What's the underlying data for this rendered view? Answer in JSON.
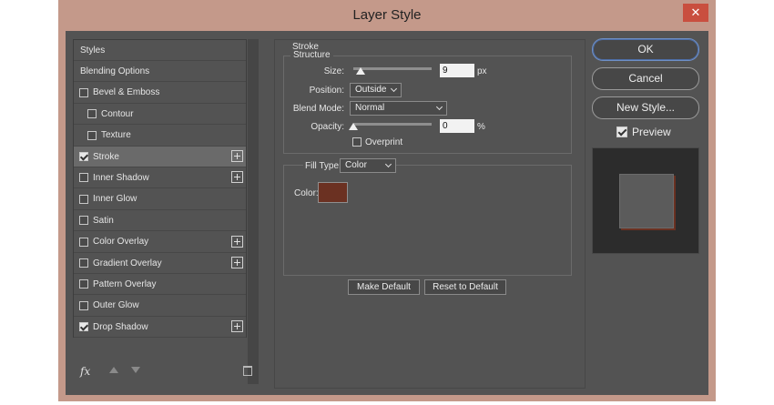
{
  "window": {
    "title": "Layer Style",
    "close_icon": "close-icon"
  },
  "styles_panel": {
    "items": [
      {
        "label": "Styles",
        "checkbox": false,
        "checked": false,
        "has_plus": false,
        "indent": false,
        "active": false
      },
      {
        "label": "Blending Options",
        "checkbox": false,
        "checked": false,
        "has_plus": false,
        "indent": false,
        "active": false
      },
      {
        "label": "Bevel & Emboss",
        "checkbox": true,
        "checked": false,
        "has_plus": false,
        "indent": false,
        "active": false
      },
      {
        "label": "Contour",
        "checkbox": true,
        "checked": false,
        "has_plus": false,
        "indent": true,
        "active": false
      },
      {
        "label": "Texture",
        "checkbox": true,
        "checked": false,
        "has_plus": false,
        "indent": true,
        "active": false
      },
      {
        "label": "Stroke",
        "checkbox": true,
        "checked": true,
        "has_plus": true,
        "indent": false,
        "active": true
      },
      {
        "label": "Inner Shadow",
        "checkbox": true,
        "checked": false,
        "has_plus": true,
        "indent": false,
        "active": false
      },
      {
        "label": "Inner Glow",
        "checkbox": true,
        "checked": false,
        "has_plus": false,
        "indent": false,
        "active": false
      },
      {
        "label": "Satin",
        "checkbox": true,
        "checked": false,
        "has_plus": false,
        "indent": false,
        "active": false
      },
      {
        "label": "Color Overlay",
        "checkbox": true,
        "checked": false,
        "has_plus": true,
        "indent": false,
        "active": false
      },
      {
        "label": "Gradient Overlay",
        "checkbox": true,
        "checked": false,
        "has_plus": true,
        "indent": false,
        "active": false
      },
      {
        "label": "Pattern Overlay",
        "checkbox": true,
        "checked": false,
        "has_plus": false,
        "indent": false,
        "active": false
      },
      {
        "label": "Outer Glow",
        "checkbox": true,
        "checked": false,
        "has_plus": false,
        "indent": false,
        "active": false
      },
      {
        "label": "Drop Shadow",
        "checkbox": true,
        "checked": true,
        "has_plus": true,
        "indent": false,
        "active": false
      }
    ],
    "footer": {
      "fx_label": "fx"
    }
  },
  "stroke": {
    "section_title": "Stroke",
    "structure_title": "Structure",
    "size_label": "Size:",
    "size_value": "9",
    "size_unit": "px",
    "position_label": "Position:",
    "position_value": "Outside",
    "blend_mode_label": "Blend Mode:",
    "blend_mode_value": "Normal",
    "opacity_label": "Opacity:",
    "opacity_value": "0",
    "opacity_unit": "%",
    "overprint_label": "Overprint",
    "fill_type_label": "Fill Type:",
    "fill_type_value": "Color",
    "color_label": "Color:",
    "color_value": "#6b3122",
    "make_default_label": "Make Default",
    "reset_default_label": "Reset to Default"
  },
  "right_panel": {
    "ok_label": "OK",
    "cancel_label": "Cancel",
    "new_style_label": "New Style...",
    "preview_label": "Preview"
  }
}
